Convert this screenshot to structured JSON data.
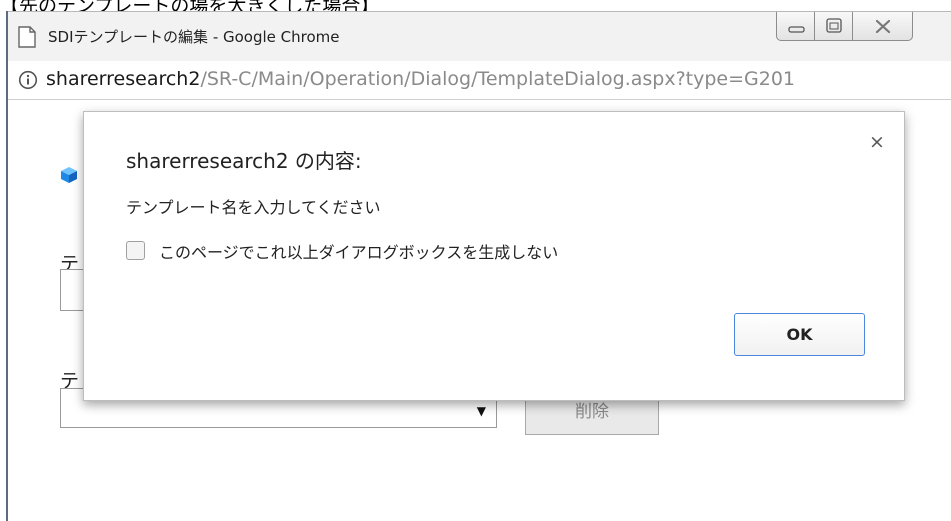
{
  "caption": "【先のテンプレートの場を大きくした場合】",
  "window": {
    "title": "SDIテンプレートの編集 - Google Chrome"
  },
  "address_bar": {
    "host": "sharerresearch2",
    "path": "/SR-C/Main/Operation/Dialog/TemplateDialog.aspx?type=G201"
  },
  "page": {
    "label1": "テ",
    "label2": "テ",
    "delete_label": "削除"
  },
  "dialog": {
    "title": "sharerresearch2 の内容:",
    "close_glyph": "×",
    "message": "テンプレート名を入力してください",
    "suppress_label": "このページでこれ以上ダイアログボックスを生成しない",
    "ok_label": "OK"
  },
  "colors": {
    "ok_border": "#4d86df",
    "cube_light": "#6fc3ff",
    "cube_dark": "#1565c0"
  }
}
